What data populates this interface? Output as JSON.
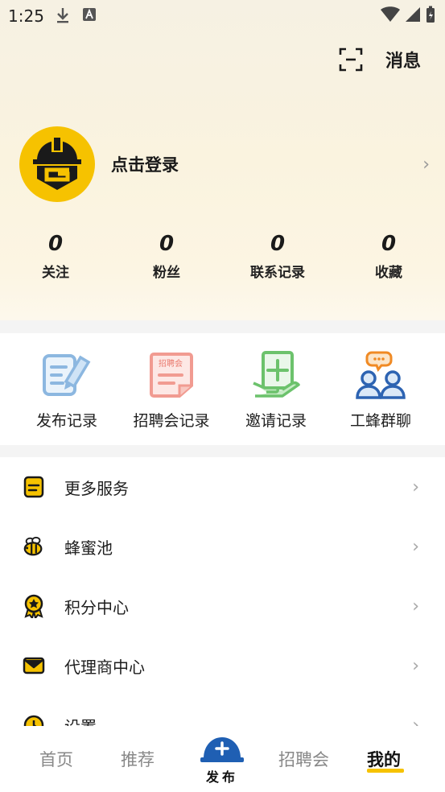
{
  "status_bar": {
    "time": "1:25"
  },
  "header": {
    "scan_icon": "scan-icon",
    "messages_label": "消息"
  },
  "profile": {
    "login_text": "点击登录",
    "avatar_icon": "helmet-g-logo"
  },
  "stats": [
    {
      "value": "0",
      "label": "关注"
    },
    {
      "value": "0",
      "label": "粉丝"
    },
    {
      "value": "0",
      "label": "联系记录"
    },
    {
      "value": "0",
      "label": "收藏"
    }
  ],
  "records": [
    {
      "label": "发布记录",
      "icon": "edit-document-icon"
    },
    {
      "label": "招聘会记录",
      "icon": "job-fair-document-icon",
      "badge": "招聘会"
    },
    {
      "label": "邀请记录",
      "icon": "invite-add-icon"
    },
    {
      "label": "工蜂群聊",
      "icon": "group-chat-icon"
    }
  ],
  "menu": [
    {
      "label": "更多服务",
      "icon": "services-icon"
    },
    {
      "label": "蜂蜜池",
      "icon": "bee-icon"
    },
    {
      "label": "积分中心",
      "icon": "medal-icon"
    },
    {
      "label": "代理商中心",
      "icon": "envelope-icon"
    },
    {
      "label": "设置",
      "icon": "settings-icon"
    }
  ],
  "tabs": [
    {
      "label": "首页"
    },
    {
      "label": "推荐"
    },
    {
      "label": "发布"
    },
    {
      "label": "招聘会"
    },
    {
      "label": "我的"
    }
  ],
  "colors": {
    "accent": "#f6c200",
    "primary_blue": "#1f5fb3"
  }
}
